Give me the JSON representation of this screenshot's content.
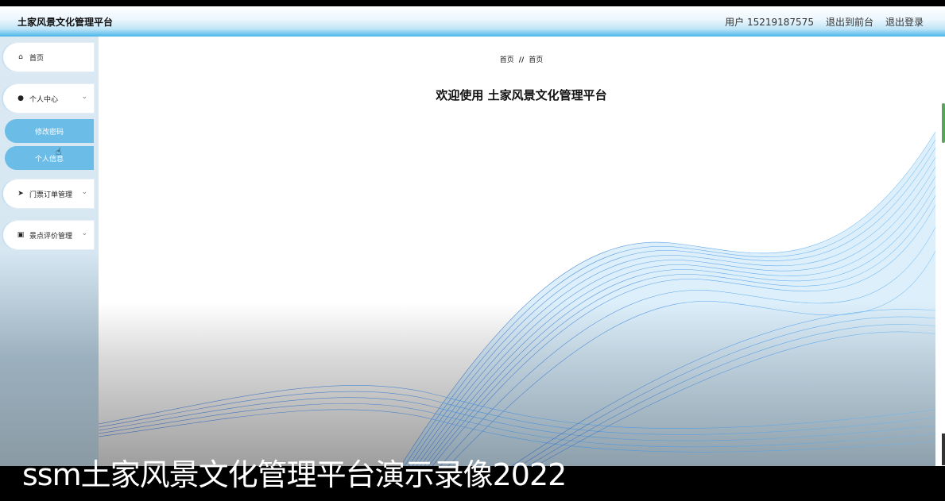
{
  "header": {
    "brand": "土家风景文化管理平台",
    "user": "用户 15219187575",
    "to_front": "退出到前台",
    "logout": "退出登录"
  },
  "sidebar": {
    "items": [
      {
        "label": "首页",
        "icon": "home-icon"
      },
      {
        "label": "个人中心",
        "icon": "user-icon",
        "sub": [
          "修改密码",
          "个人信息"
        ]
      },
      {
        "label": "门票订单管理",
        "icon": "send-icon"
      },
      {
        "label": "景点评价管理",
        "icon": "chart-icon"
      }
    ]
  },
  "main": {
    "breadcrumb": [
      "首页",
      "首页"
    ],
    "welcome": "欢迎使用 土家风景文化管理平台"
  },
  "caption": "ssm土家风景文化管理平台演示录像2022",
  "colors": {
    "accent": "#48b6ea",
    "submenu": "#6bbce6",
    "wave": "#1a7fe0"
  }
}
